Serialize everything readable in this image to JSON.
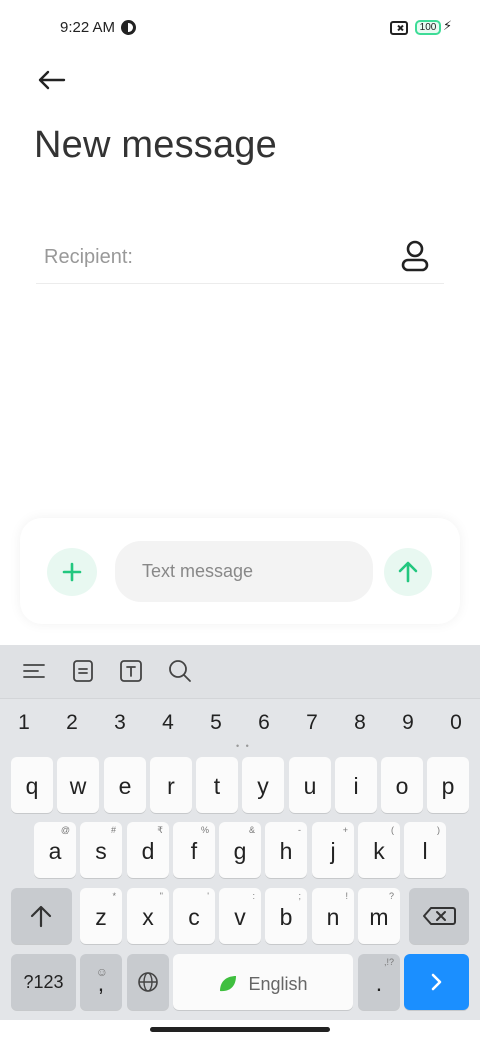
{
  "status_bar": {
    "time": "9:22 AM",
    "battery": "100"
  },
  "header": {
    "title": "New message"
  },
  "recipient": {
    "label": "Recipient:"
  },
  "composer": {
    "placeholder": "Text message"
  },
  "keyboard": {
    "numbers": [
      "1",
      "2",
      "3",
      "4",
      "5",
      "6",
      "7",
      "8",
      "9",
      "0"
    ],
    "row1": [
      "q",
      "w",
      "e",
      "r",
      "t",
      "y",
      "u",
      "i",
      "o",
      "p"
    ],
    "row2": [
      "a",
      "s",
      "d",
      "f",
      "g",
      "h",
      "j",
      "k",
      "l"
    ],
    "row2_sub": [
      "@",
      "#",
      "₹",
      "%",
      "&",
      "-",
      "+",
      "(",
      ")"
    ],
    "row3": [
      "z",
      "x",
      "c",
      "v",
      "b",
      "n",
      "m"
    ],
    "row3_sub": [
      "*",
      "\"",
      "'",
      ":",
      ";",
      "!",
      "?"
    ],
    "symbols_key": "?123",
    "comma_key": ",",
    "period_key": ".",
    "period_sub": ",!?",
    "space_label": "English"
  },
  "colors": {
    "accent": "#3ddc97",
    "accent_bg": "#e8f8f1",
    "enter_blue": "#1b8fff"
  }
}
